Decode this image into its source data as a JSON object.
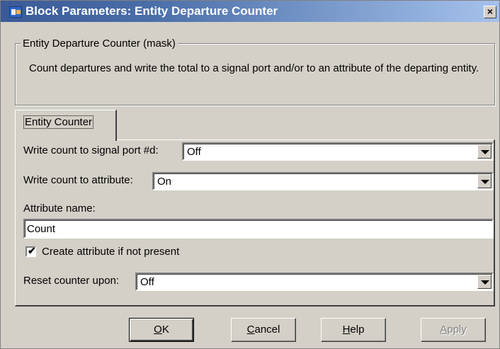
{
  "window": {
    "title": "Block Parameters: Entity Departure Counter",
    "close_glyph": "×"
  },
  "mask": {
    "legend": "Entity Departure Counter (mask)",
    "description": "Count departures and write the total to a signal port and/or to an attribute of the departing entity."
  },
  "tabs": [
    {
      "label": "Entity Counter",
      "selected": true
    }
  ],
  "params": {
    "signal_port_label": "Write count to signal port #d:",
    "signal_port_value": "Off",
    "attribute_label": "Write count to attribute:",
    "attribute_value": "On",
    "attribute_name_label": "Attribute name:",
    "attribute_name_value": "Count",
    "create_attr_label": "Create attribute if not present",
    "create_attr_checked": true,
    "reset_label": "Reset counter upon:",
    "reset_value": "Off"
  },
  "buttons": {
    "ok": {
      "mnemonic": "O",
      "rest": "K"
    },
    "cancel": {
      "mnemonic": "C",
      "rest": "ancel"
    },
    "help": {
      "mnemonic": "H",
      "rest": "elp"
    },
    "apply": {
      "mnemonic": "A",
      "rest": "pply",
      "disabled": true
    }
  },
  "icons": {
    "app": "simulink-block-icon",
    "close": "close-icon",
    "dropdown": "chevron-down-icon",
    "check": "checkmark-icon"
  }
}
